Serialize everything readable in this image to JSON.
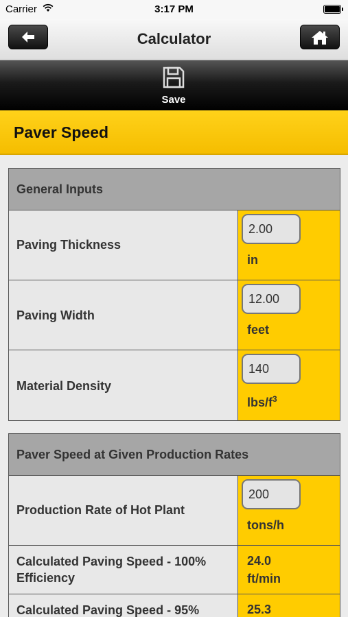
{
  "status_bar": {
    "carrier": "Carrier",
    "time": "3:17 PM"
  },
  "nav": {
    "title": "Calculator"
  },
  "toolbar": {
    "save_label": "Save"
  },
  "section": {
    "title": "Paver Speed"
  },
  "general_inputs": {
    "heading": "General Inputs",
    "rows": [
      {
        "label": "Paving Thickness",
        "value": "2.00",
        "unit": "in"
      },
      {
        "label": "Paving Width",
        "value": "12.00",
        "unit": "feet"
      },
      {
        "label": "Material Density",
        "value": "140",
        "unit": "lbs/f",
        "unit_sup": "3"
      }
    ]
  },
  "production_rates": {
    "heading": "Paver Speed at Given Production Rates",
    "input_row": {
      "label": "Production Rate of Hot Plant",
      "value": "200",
      "unit": "tons/h"
    },
    "calc_rows": [
      {
        "label": "Calculated Paving Speed - 100% Efficiency",
        "value": "24.0",
        "unit": "ft/min"
      },
      {
        "label": "Calculated Paving Speed - 95%",
        "value": "25.3"
      }
    ]
  },
  "colors": {
    "accent": "#ffcc00",
    "toolbar": "#000000",
    "panel_header": "#a6a6a6"
  }
}
